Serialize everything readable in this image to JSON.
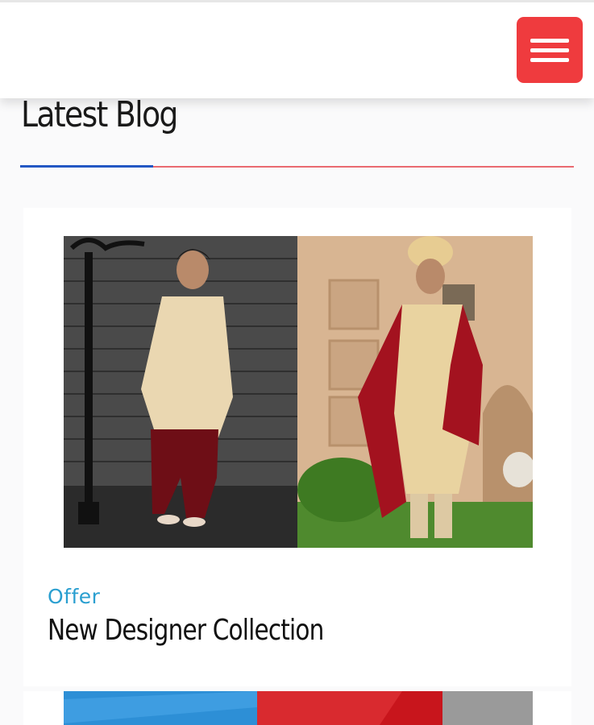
{
  "header": {
    "menu_icon": "hamburger-menu-icon",
    "menu_color": "#ef3b3e"
  },
  "section": {
    "title": "Latest Blog",
    "accent_color": "#2357c4",
    "rule_color": "#ea6a70"
  },
  "posts": [
    {
      "category": "Offer",
      "title": "New Designer Collection",
      "category_color": "#2a9fd0"
    }
  ]
}
